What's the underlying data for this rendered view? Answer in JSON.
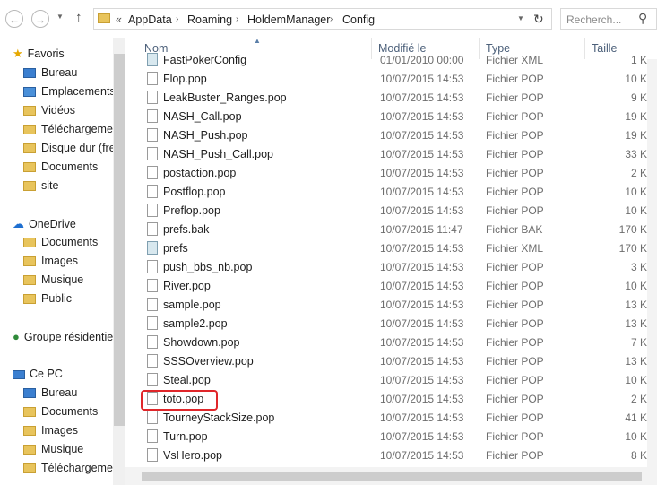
{
  "address": {
    "chevrons": "«",
    "crumbs": [
      "AppData",
      "Roaming",
      "HoldemManager",
      "Config"
    ],
    "search_placeholder": "Recherch..."
  },
  "nav": {
    "favorites_label": "Favoris",
    "favorites": [
      "Bureau",
      "Emplacements",
      "Vidéos",
      "Téléchargements",
      "Disque dur (fre",
      "Documents",
      "site"
    ],
    "onedrive_label": "OneDrive",
    "onedrive": [
      "Documents",
      "Images",
      "Musique",
      "Public"
    ],
    "homegroup_label": "Groupe résidentiel",
    "pc_label": "Ce PC",
    "pc": [
      "Bureau",
      "Documents",
      "Images",
      "Musique",
      "Téléchargements"
    ]
  },
  "columns": {
    "name": "Nom",
    "modified": "Modifié le",
    "type": "Type",
    "size": "Taille"
  },
  "files": [
    {
      "name": "FastPokerConfig",
      "date": "01/01/2010 00:00",
      "type": "Fichier XML",
      "size": "1 K",
      "kind": "xml"
    },
    {
      "name": "Flop.pop",
      "date": "10/07/2015 14:53",
      "type": "Fichier POP",
      "size": "10 K",
      "kind": "pop"
    },
    {
      "name": "LeakBuster_Ranges.pop",
      "date": "10/07/2015 14:53",
      "type": "Fichier POP",
      "size": "9 K",
      "kind": "pop"
    },
    {
      "name": "NASH_Call.pop",
      "date": "10/07/2015 14:53",
      "type": "Fichier POP",
      "size": "19 K",
      "kind": "pop"
    },
    {
      "name": "NASH_Push.pop",
      "date": "10/07/2015 14:53",
      "type": "Fichier POP",
      "size": "19 K",
      "kind": "pop"
    },
    {
      "name": "NASH_Push_Call.pop",
      "date": "10/07/2015 14:53",
      "type": "Fichier POP",
      "size": "33 K",
      "kind": "pop"
    },
    {
      "name": "postaction.pop",
      "date": "10/07/2015 14:53",
      "type": "Fichier POP",
      "size": "2 K",
      "kind": "pop"
    },
    {
      "name": "Postflop.pop",
      "date": "10/07/2015 14:53",
      "type": "Fichier POP",
      "size": "10 K",
      "kind": "pop"
    },
    {
      "name": "Preflop.pop",
      "date": "10/07/2015 14:53",
      "type": "Fichier POP",
      "size": "10 K",
      "kind": "pop"
    },
    {
      "name": "prefs.bak",
      "date": "10/07/2015 11:47",
      "type": "Fichier BAK",
      "size": "170 K",
      "kind": "pop"
    },
    {
      "name": "prefs",
      "date": "10/07/2015 14:53",
      "type": "Fichier XML",
      "size": "170 K",
      "kind": "xml"
    },
    {
      "name": "push_bbs_nb.pop",
      "date": "10/07/2015 14:53",
      "type": "Fichier POP",
      "size": "3 K",
      "kind": "pop"
    },
    {
      "name": "River.pop",
      "date": "10/07/2015 14:53",
      "type": "Fichier POP",
      "size": "10 K",
      "kind": "pop"
    },
    {
      "name": "sample.pop",
      "date": "10/07/2015 14:53",
      "type": "Fichier POP",
      "size": "13 K",
      "kind": "pop"
    },
    {
      "name": "sample2.pop",
      "date": "10/07/2015 14:53",
      "type": "Fichier POP",
      "size": "13 K",
      "kind": "pop"
    },
    {
      "name": "Showdown.pop",
      "date": "10/07/2015 14:53",
      "type": "Fichier POP",
      "size": "7 K",
      "kind": "pop"
    },
    {
      "name": "SSSOverview.pop",
      "date": "10/07/2015 14:53",
      "type": "Fichier POP",
      "size": "13 K",
      "kind": "pop"
    },
    {
      "name": "Steal.pop",
      "date": "10/07/2015 14:53",
      "type": "Fichier POP",
      "size": "10 K",
      "kind": "pop"
    },
    {
      "name": "toto.pop",
      "date": "10/07/2015 14:53",
      "type": "Fichier POP",
      "size": "2 K",
      "kind": "pop"
    },
    {
      "name": "TourneyStackSize.pop",
      "date": "10/07/2015 14:53",
      "type": "Fichier POP",
      "size": "41 K",
      "kind": "pop"
    },
    {
      "name": "Turn.pop",
      "date": "10/07/2015 14:53",
      "type": "Fichier POP",
      "size": "10 K",
      "kind": "pop"
    },
    {
      "name": "VsHero.pop",
      "date": "10/07/2015 14:53",
      "type": "Fichier POP",
      "size": "8 K",
      "kind": "pop"
    }
  ],
  "colors": {
    "highlight": "#e0262a",
    "header_text": "#4c607a"
  }
}
